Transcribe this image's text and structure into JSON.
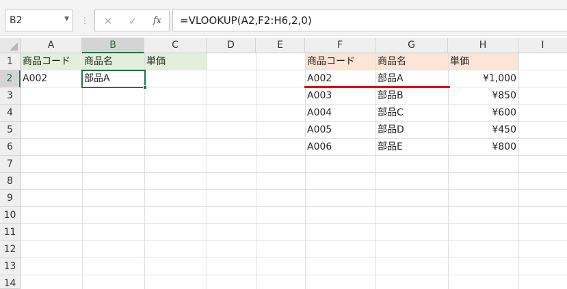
{
  "formula_bar": {
    "name_box": "B2",
    "formula": "=VLOOKUP(A2,F2:H6,2,0)",
    "fx_label": "fx"
  },
  "columns": [
    "A",
    "B",
    "C",
    "D",
    "E",
    "F",
    "G",
    "H",
    "I"
  ],
  "rows": [
    "1",
    "2",
    "3",
    "4",
    "5",
    "6",
    "7",
    "8",
    "9",
    "10",
    "11",
    "12",
    "13",
    "14"
  ],
  "active_cell": "B2",
  "colors": {
    "lookup_header_fill": "#e2efda",
    "table_header_fill": "#fce4d6",
    "accent": "#217346",
    "underline": "#e00000"
  },
  "lookup": {
    "headers": [
      "商品コード",
      "商品名",
      "単価"
    ],
    "row": {
      "code": "A002",
      "name": "部品A",
      "price": ""
    }
  },
  "table": {
    "headers": [
      "商品コード",
      "商品名",
      "単価"
    ],
    "rows": [
      [
        "A002",
        "部品A",
        "¥1,000"
      ],
      [
        "A003",
        "部品B",
        "¥850"
      ],
      [
        "A004",
        "部品C",
        "¥600"
      ],
      [
        "A005",
        "部品D",
        "¥450"
      ],
      [
        "A006",
        "部品E",
        "¥800"
      ]
    ]
  }
}
